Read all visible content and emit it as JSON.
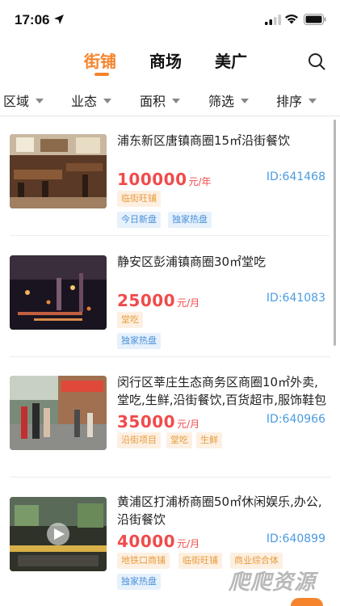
{
  "status": {
    "time": "17:06"
  },
  "tabs": [
    {
      "label": "街铺",
      "active": true
    },
    {
      "label": "商场",
      "active": false
    },
    {
      "label": "美广",
      "active": false
    }
  ],
  "filters": [
    "区域",
    "业态",
    "面积",
    "筛选",
    "排序"
  ],
  "listings": [
    {
      "title": "浦东新区唐镇商圈15㎡沿街餐饮",
      "price": "100000",
      "unit": "元/年",
      "id": "ID:641468",
      "tags_orange": [
        "临街旺铺"
      ],
      "tags_blue": [
        "今日新盘",
        "独家热盘"
      ]
    },
    {
      "title": "静安区彭浦镇商圈30㎡堂吃",
      "price": "25000",
      "unit": "元/月",
      "id": "ID:641083",
      "tags_orange": [
        "堂吃"
      ],
      "tags_blue": [
        "独家热盘"
      ]
    },
    {
      "title": "闵行区莘庄生态商务区商圈10㎡外卖,堂吃,生鲜,沿街餐饮,百货超市,服饰鞋包",
      "price": "35000",
      "unit": "元/月",
      "id": "ID:640966",
      "tags_orange": [
        "沿街项目",
        "堂吃",
        "生鲜"
      ],
      "tags_blue": []
    },
    {
      "title": "黄浦区打浦桥商圈50㎡休闲娱乐,办公,沿街餐饮",
      "price": "40000",
      "unit": "元/月",
      "id": "ID:640899",
      "tags_orange": [
        "地铁口商铺",
        "临街旺铺",
        "商业综合体"
      ],
      "tags_blue": [
        "独家热盘"
      ]
    }
  ],
  "watermark": "爬爬资源",
  "colors": {
    "accent": "#f5842c",
    "price": "#f04b4b",
    "id": "#4a9be0"
  }
}
